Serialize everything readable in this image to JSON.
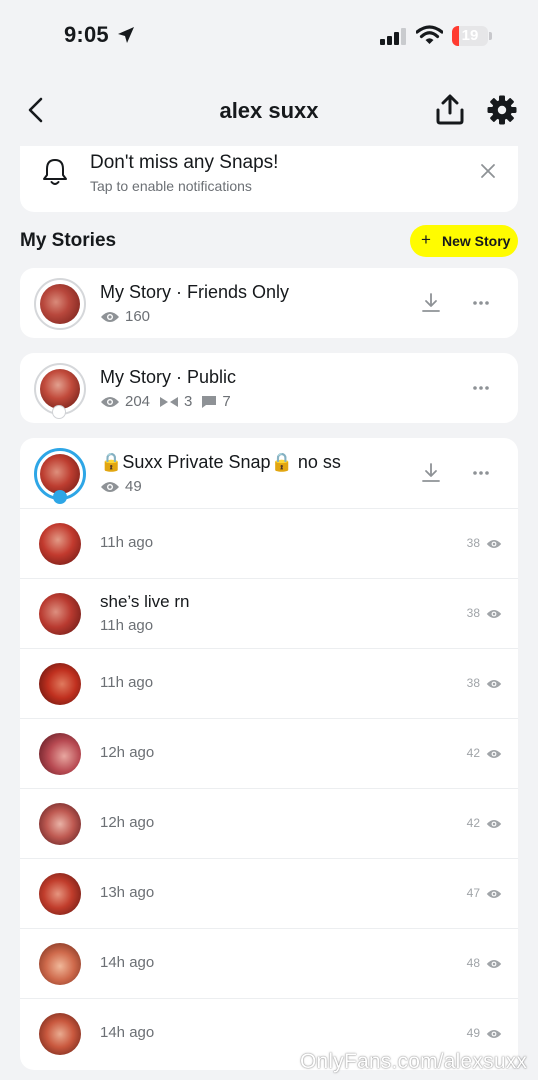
{
  "status_bar": {
    "time": "9:05",
    "battery": "19",
    "battery_level": 0.19
  },
  "nav": {
    "title": "alex suxx",
    "back_icon": "chevron-left-icon",
    "share_icon": "share-upload-icon",
    "settings_icon": "gear-icon"
  },
  "notification_banner": {
    "title": "Don't miss any Snaps!",
    "subtitle": "Tap to enable notifications"
  },
  "my_stories": {
    "heading": "My Stories",
    "new_story_label": "New Story",
    "new_story_color": "#fffc00"
  },
  "stories": [
    {
      "name": "My Story · Friends Only",
      "views": "160"
    },
    {
      "name": "My Story · Public",
      "views": "204",
      "screenshots": "3",
      "replies": "7"
    },
    {
      "name": "🔒Suxx Private Snap🔒 no ss",
      "views": "49"
    }
  ],
  "snaps": [
    {
      "time": "11h ago",
      "views": "38"
    },
    {
      "title": "she’s live rn",
      "time": "11h ago",
      "views": "38"
    },
    {
      "time": "11h ago",
      "views": "38"
    },
    {
      "time": "12h ago",
      "views": "42"
    },
    {
      "time": "12h ago",
      "views": "42"
    },
    {
      "time": "13h ago",
      "views": "47"
    },
    {
      "time": "14h ago",
      "views": "48"
    },
    {
      "time": "14h ago",
      "views": "49"
    }
  ],
  "watermark": "OnlyFans.com/alexsuxx",
  "colors": {
    "accent_blue": "#2ea6e6",
    "battery_red": "#ff3b30",
    "text_primary": "#16191c",
    "text_secondary": "#6c7075"
  }
}
